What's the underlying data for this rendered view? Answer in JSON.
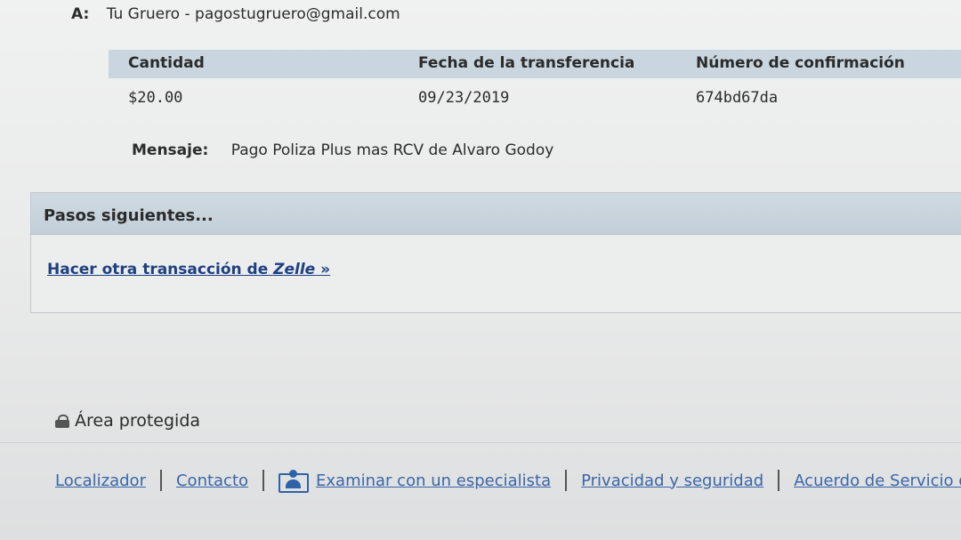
{
  "recipient": {
    "label": "A:",
    "value": "Tu Gruero - pagostugruero@gmail.com"
  },
  "transfer_table": {
    "headers": [
      "Cantidad",
      "Fecha de la transferencia",
      "Número de confirmación"
    ],
    "row": [
      "$20.00",
      "09/23/2019",
      "674bd67da"
    ]
  },
  "message": {
    "label": "Mensaje:",
    "value": "Pago Poliza Plus mas RCV de Alvaro Godoy"
  },
  "next_steps": {
    "title": "Pasos siguientes...",
    "link_prefix": "Hacer otra transacción de ",
    "link_brand": "Zelle",
    "link_suffix": " »"
  },
  "secure_area": {
    "icon": "lock-icon",
    "label": "Área protegida"
  },
  "footer": {
    "locator": "Localizador",
    "contact": "Contacto",
    "expert": "Examinar con un especialista",
    "expert_icon": "specialist-icon",
    "privacy": "Privacidad y seguridad",
    "agreement": "Acuerdo de Servicio de la"
  },
  "colors": {
    "link": "#1f3f83",
    "footer_link": "#3a66a8",
    "header_band": "#c9d6df"
  }
}
